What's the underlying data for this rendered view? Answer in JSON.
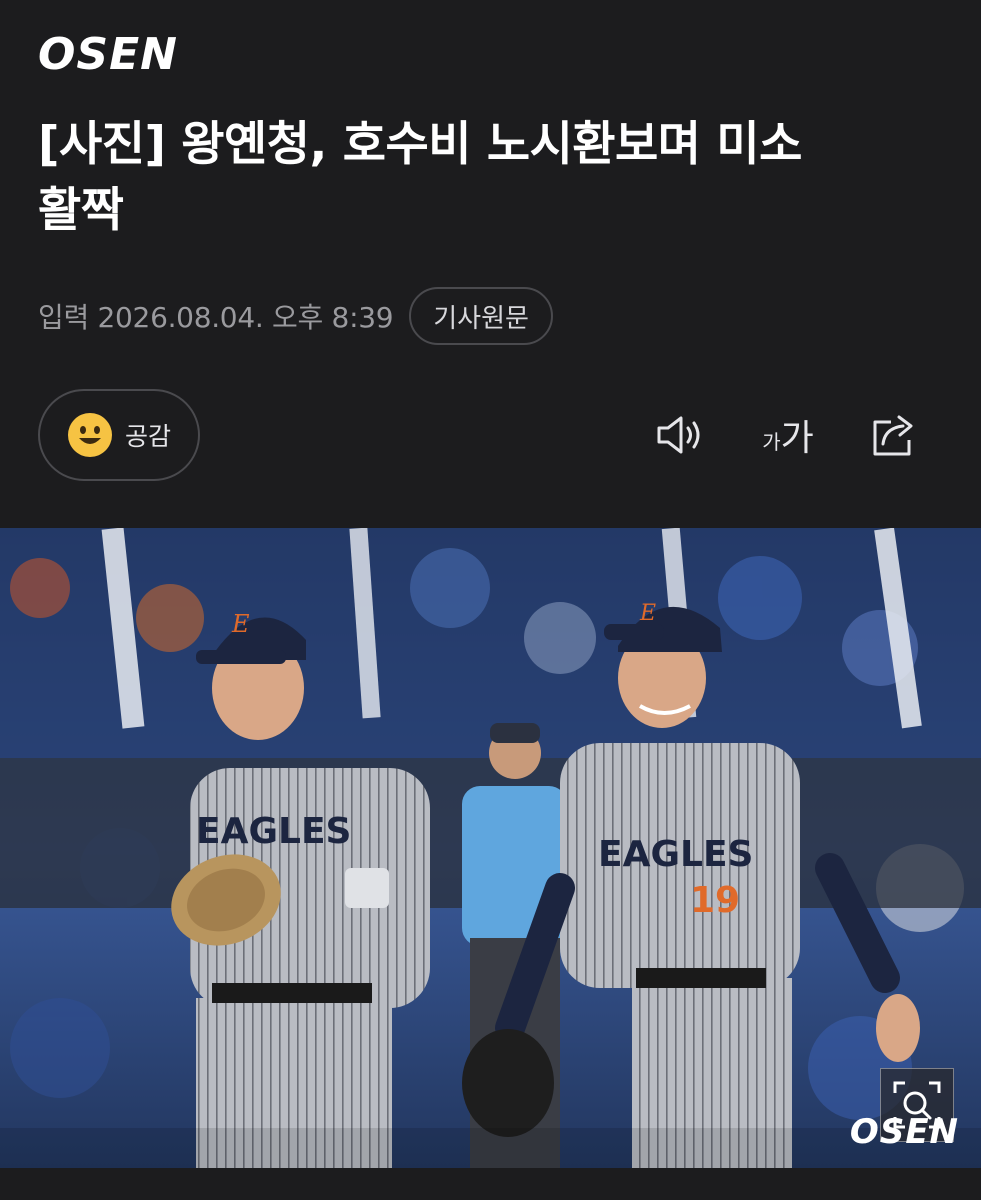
{
  "brand": {
    "logo_text": "OSEN"
  },
  "article": {
    "title_line1": "[사진] 왕옌청, 호수비 노시환보며 미소",
    "title_line2": "활짝",
    "published": "입력 2026.08.04. 오후 8:39",
    "original_link_label": "기사원문"
  },
  "actions": {
    "like_label": "공감",
    "font_small": "가",
    "font_large": "가"
  },
  "photo": {
    "watermark": "OSEN",
    "jersey_text": "EAGLES",
    "jersey_number": "19"
  },
  "icons": {
    "like": "smile-emoji-icon",
    "speaker": "speaker-icon",
    "share": "share-icon",
    "zoom": "zoom-icon"
  },
  "colors": {
    "background": "#1c1c1e",
    "meta_text": "#9a9a9e",
    "border": "#4a4a4e",
    "emoji": "#f6c343",
    "jersey_number": "#e06a2a"
  }
}
